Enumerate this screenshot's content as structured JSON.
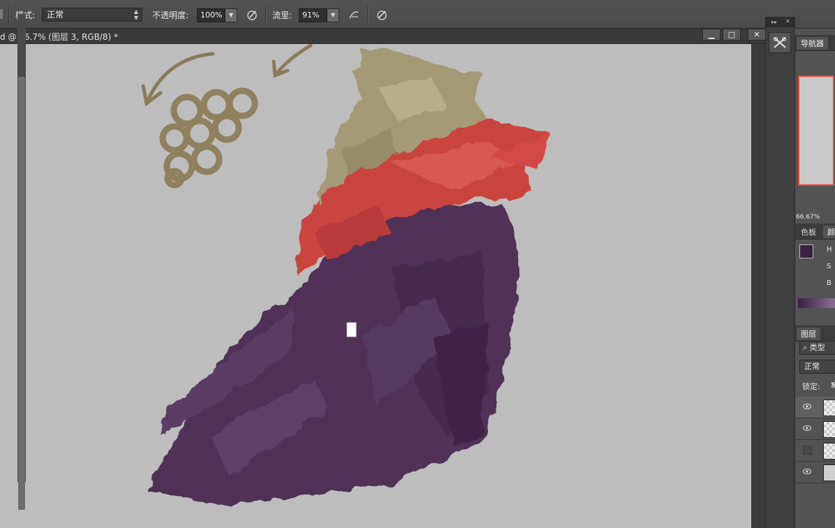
{
  "options_bar": {
    "mode_label": "模式:",
    "mode_value": "正常",
    "opacity_label": "不透明度:",
    "opacity_value": "100%",
    "flow_label": "流里:",
    "flow_value": "91%",
    "icons": [
      "airbrush-pressure-icon",
      "airbrush-icon",
      "tablet-pressure-size-icon"
    ]
  },
  "document": {
    "tab_title": "d @ 66.7% (图层 3, RGB/8) *",
    "window_buttons": {
      "minimize": "▁",
      "restore": "□",
      "close": "✕"
    }
  },
  "dock": {
    "collapse_glyph": "▸▸",
    "close_glyph": "✕",
    "tool_icon": "brush-presets-icon"
  },
  "panels": {
    "navigator": {
      "tab": "导航器",
      "zoom": "66.67%"
    },
    "color": {
      "tabs": [
        "色板",
        "颜"
      ],
      "labels": [
        "H",
        "S",
        "B"
      ],
      "foreground_color": "#3a2240",
      "background_color": "#ffffff"
    },
    "layers": {
      "tab": "图层",
      "search_label": "类型",
      "blend_mode": "正常",
      "lock_label": "锁定:",
      "rows": [
        {
          "visible": true,
          "thumb": "transparent",
          "selected": true
        },
        {
          "visible": true,
          "thumb": "transparent",
          "selected": false
        },
        {
          "visible": false,
          "thumb": "transparent",
          "selected": false
        },
        {
          "visible": true,
          "thumb": "solid",
          "selected": false
        }
      ]
    }
  },
  "colors": {
    "canvas": "#bdbdbd",
    "grape_purple": "#4f3357",
    "leaf_red": "#c9443f",
    "leaf_khaki": "#a59a78",
    "sketch_brown": "#8a7b5c"
  }
}
